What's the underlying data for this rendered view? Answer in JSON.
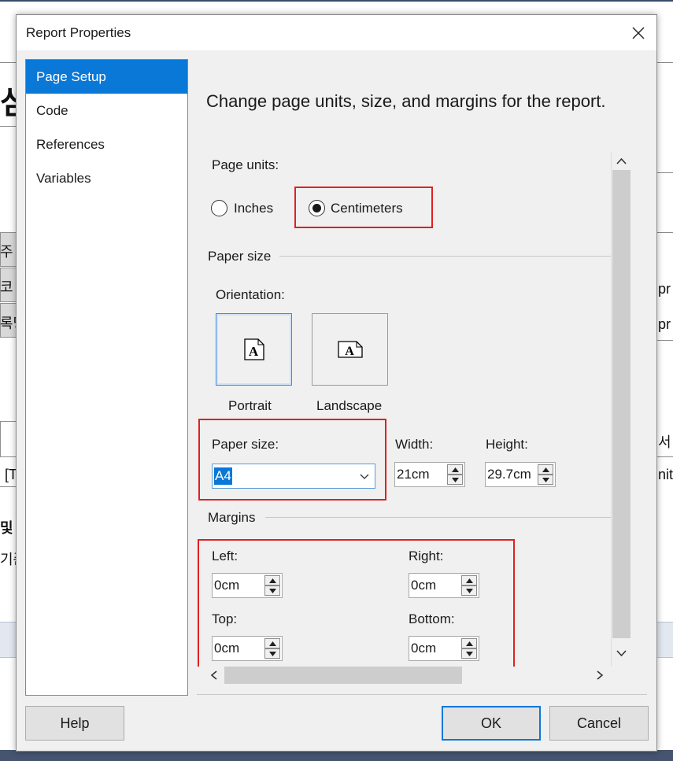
{
  "dialog": {
    "title": "Report Properties",
    "close_icon": "close-icon"
  },
  "nav": {
    "items": [
      {
        "label": "Page Setup",
        "selected": true
      },
      {
        "label": "Code",
        "selected": false
      },
      {
        "label": "References",
        "selected": false
      },
      {
        "label": "Variables",
        "selected": false
      }
    ]
  },
  "page_setup": {
    "heading": "Change page units, size, and margins for the report.",
    "page_units": {
      "label": "Page units:",
      "options": [
        "Inches",
        "Centimeters"
      ],
      "selected": "Centimeters"
    },
    "paper_size_group": {
      "label": "Paper size",
      "orientation_label": "Orientation:",
      "orientations": [
        "Portrait",
        "Landscape"
      ],
      "selected_orientation": "Portrait",
      "paper_size_label": "Paper size:",
      "paper_size_value": "A4",
      "width_label": "Width:",
      "width_value": "21cm",
      "height_label": "Height:",
      "height_value": "29.7cm"
    },
    "margins_group": {
      "label": "Margins",
      "left_label": "Left:",
      "left_value": "0cm",
      "right_label": "Right:",
      "right_value": "0cm",
      "top_label": "Top:",
      "top_value": "0cm",
      "bottom_label": "Bottom:",
      "bottom_value": "0cm"
    }
  },
  "buttons": {
    "help": "Help",
    "ok": "OK",
    "cancel": "Cancel"
  },
  "background": {
    "fragments_left": [
      "섬",
      "주",
      "코",
      "록당",
      "[T",
      "및",
      "기준"
    ],
    "fragments_right": [
      "pr",
      "pr",
      "서",
      "nitl"
    ]
  },
  "colors": {
    "accent": "#0a78d7",
    "highlight_box": "#e02020"
  }
}
